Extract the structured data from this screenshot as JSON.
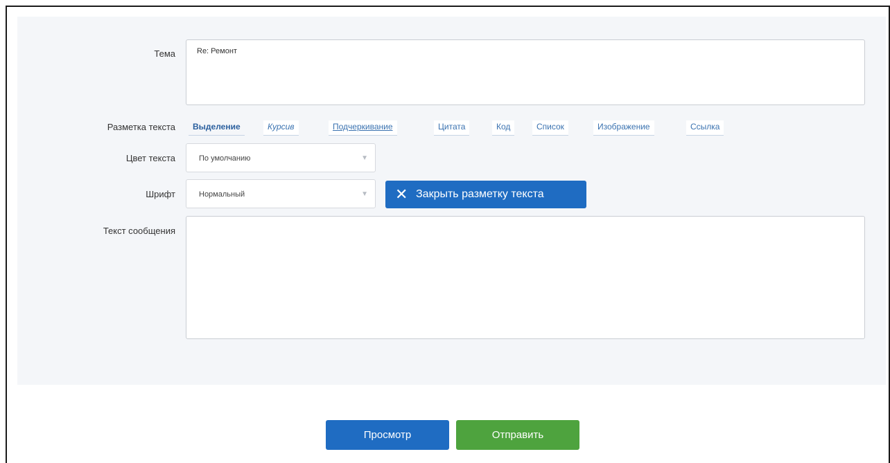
{
  "form": {
    "subject_label": "Тема",
    "subject_value": "Re: Ремонт",
    "markup_label": "Разметка текста",
    "markup_buttons": [
      "Выделение",
      "Курсив",
      "Подчеркивание",
      "Цитата",
      "Код",
      "Список",
      "Изображение",
      "Ссылка"
    ],
    "color_label": "Цвет текста",
    "color_value": "По умолчанию",
    "font_label": "Шрифт",
    "font_value": "Нормальный",
    "close_markup_label": "Закрыть разметку текста",
    "message_label": "Текст сообщения",
    "message_value": ""
  },
  "actions": {
    "preview_label": "Просмотр",
    "send_label": "Отправить"
  },
  "icons": {
    "select_arrow": "chevron-down-icon",
    "close": "close-icon"
  },
  "colors": {
    "primary": "#1f6cc2",
    "success": "#4ea33e",
    "panel_bg": "#f4f6f9"
  }
}
